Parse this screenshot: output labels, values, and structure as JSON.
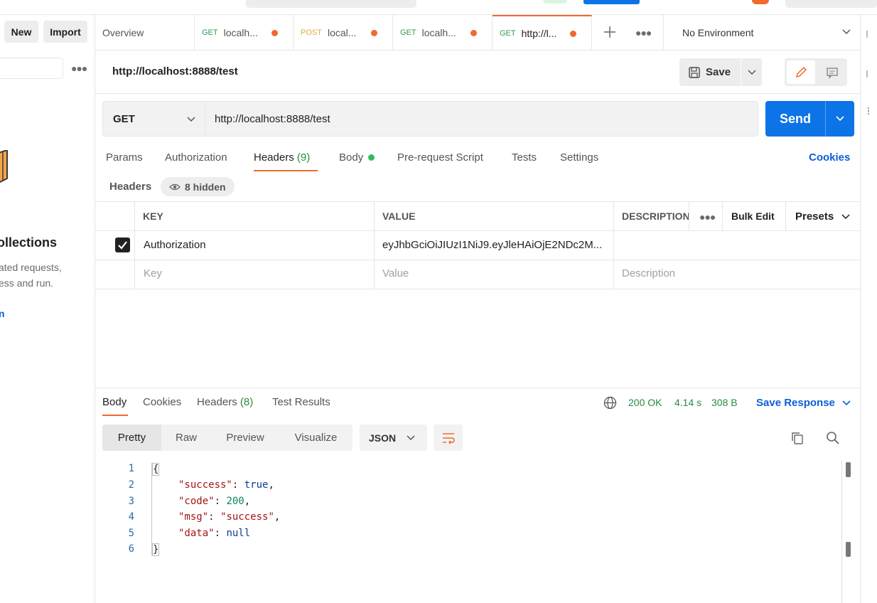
{
  "sidebar": {
    "new_label": "New",
    "import_label": "Import",
    "empty_title": "ollections",
    "empty_text_1": "ated requests,",
    "empty_text_2": "ess and run.",
    "empty_link": "n"
  },
  "tabs": [
    {
      "label": "Overview"
    },
    {
      "method": "GET",
      "label": "localh..."
    },
    {
      "method": "POST",
      "label": "local..."
    },
    {
      "method": "GET",
      "label": "localh..."
    },
    {
      "method": "GET",
      "label": "http://l..."
    }
  ],
  "environment": {
    "label": "No Environment"
  },
  "request": {
    "title": "http://localhost:8888/test",
    "save_label": "Save",
    "method": "GET",
    "url": "http://localhost:8888/test",
    "send_label": "Send",
    "cookies_label": "Cookies"
  },
  "request_tabs": {
    "params": "Params",
    "authorization": "Authorization",
    "headers": "Headers",
    "headers_count": "(9)",
    "body": "Body",
    "prerequest": "Pre-request Script",
    "tests": "Tests",
    "settings": "Settings"
  },
  "headers_section": {
    "label": "Headers",
    "hidden_label": "8 hidden",
    "columns": {
      "key": "KEY",
      "value": "VALUE",
      "description": "DESCRIPTION"
    },
    "bulk_edit": "Bulk Edit",
    "presets": "Presets",
    "rows": [
      {
        "checked": true,
        "key": "Authorization",
        "value": "eyJhbGciOiJIUzI1NiJ9.eyJleHAiOjE2NDc2M...",
        "description": ""
      }
    ],
    "placeholders": {
      "key": "Key",
      "value": "Value",
      "description": "Description"
    }
  },
  "response": {
    "tabs": {
      "body": "Body",
      "cookies": "Cookies",
      "headers": "Headers",
      "headers_count": "(8)",
      "test_results": "Test Results"
    },
    "status": "200 OK",
    "time": "4.14 s",
    "size": "308 B",
    "save_response": "Save Response",
    "views": {
      "pretty": "Pretty",
      "raw": "Raw",
      "preview": "Preview",
      "visualize": "Visualize"
    },
    "format": "JSON",
    "code_lines": [
      "1",
      "2",
      "3",
      "4",
      "5",
      "6"
    ],
    "json": {
      "open": "{",
      "close": "}",
      "k_success": "\"success\"",
      "v_success": "true",
      "k_code": "\"code\"",
      "v_code": "200",
      "k_msg": "\"msg\"",
      "v_msg": "\"success\"",
      "k_data": "\"data\"",
      "v_data": "null",
      "colon": ": ",
      "comma": ","
    }
  },
  "colors": {
    "accent": "#ef6a2d",
    "primary": "#0d74e7",
    "get": "#2a9d4a",
    "post": "#e2a93b"
  }
}
